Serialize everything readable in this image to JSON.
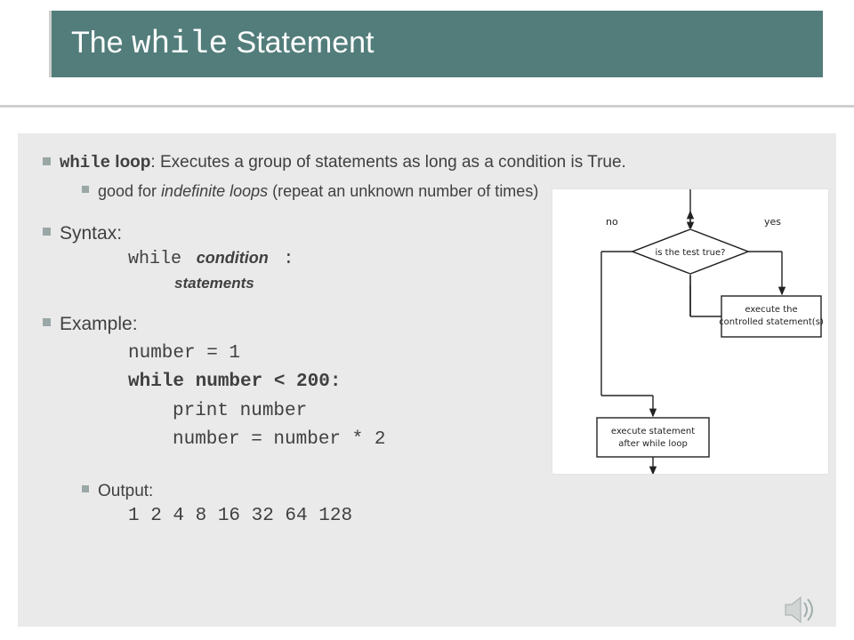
{
  "title": {
    "pre": "The ",
    "mono": "while",
    "post": " Statement"
  },
  "bullets": {
    "b1_label": "while",
    "b1_rest": " loop",
    "b1_desc": ": Executes a group of statements as long as a condition is True.",
    "b1_sub_pre": "good for ",
    "b1_sub_ital": "indefinite loops",
    "b1_sub_post": " (repeat an unknown number of times)",
    "b2": "Syntax:",
    "syntax_while": "while",
    "syntax_cond": "condition",
    "syntax_colon": ":",
    "syntax_stmts": "statements",
    "b3": "Example:",
    "code_l1": "number = 1",
    "code_l2": "while number < 200:",
    "code_l3": "print number",
    "code_l4": "number = number * 2",
    "out_label": "Output:",
    "out_val": "1 2 4 8 16 32 64 128"
  },
  "flow": {
    "diamond": "is the test true?",
    "no": "no",
    "yes": "yes",
    "box1a": "execute the",
    "box1b": "controlled statement(s)",
    "box2a": "execute statement",
    "box2b": "after while loop"
  }
}
